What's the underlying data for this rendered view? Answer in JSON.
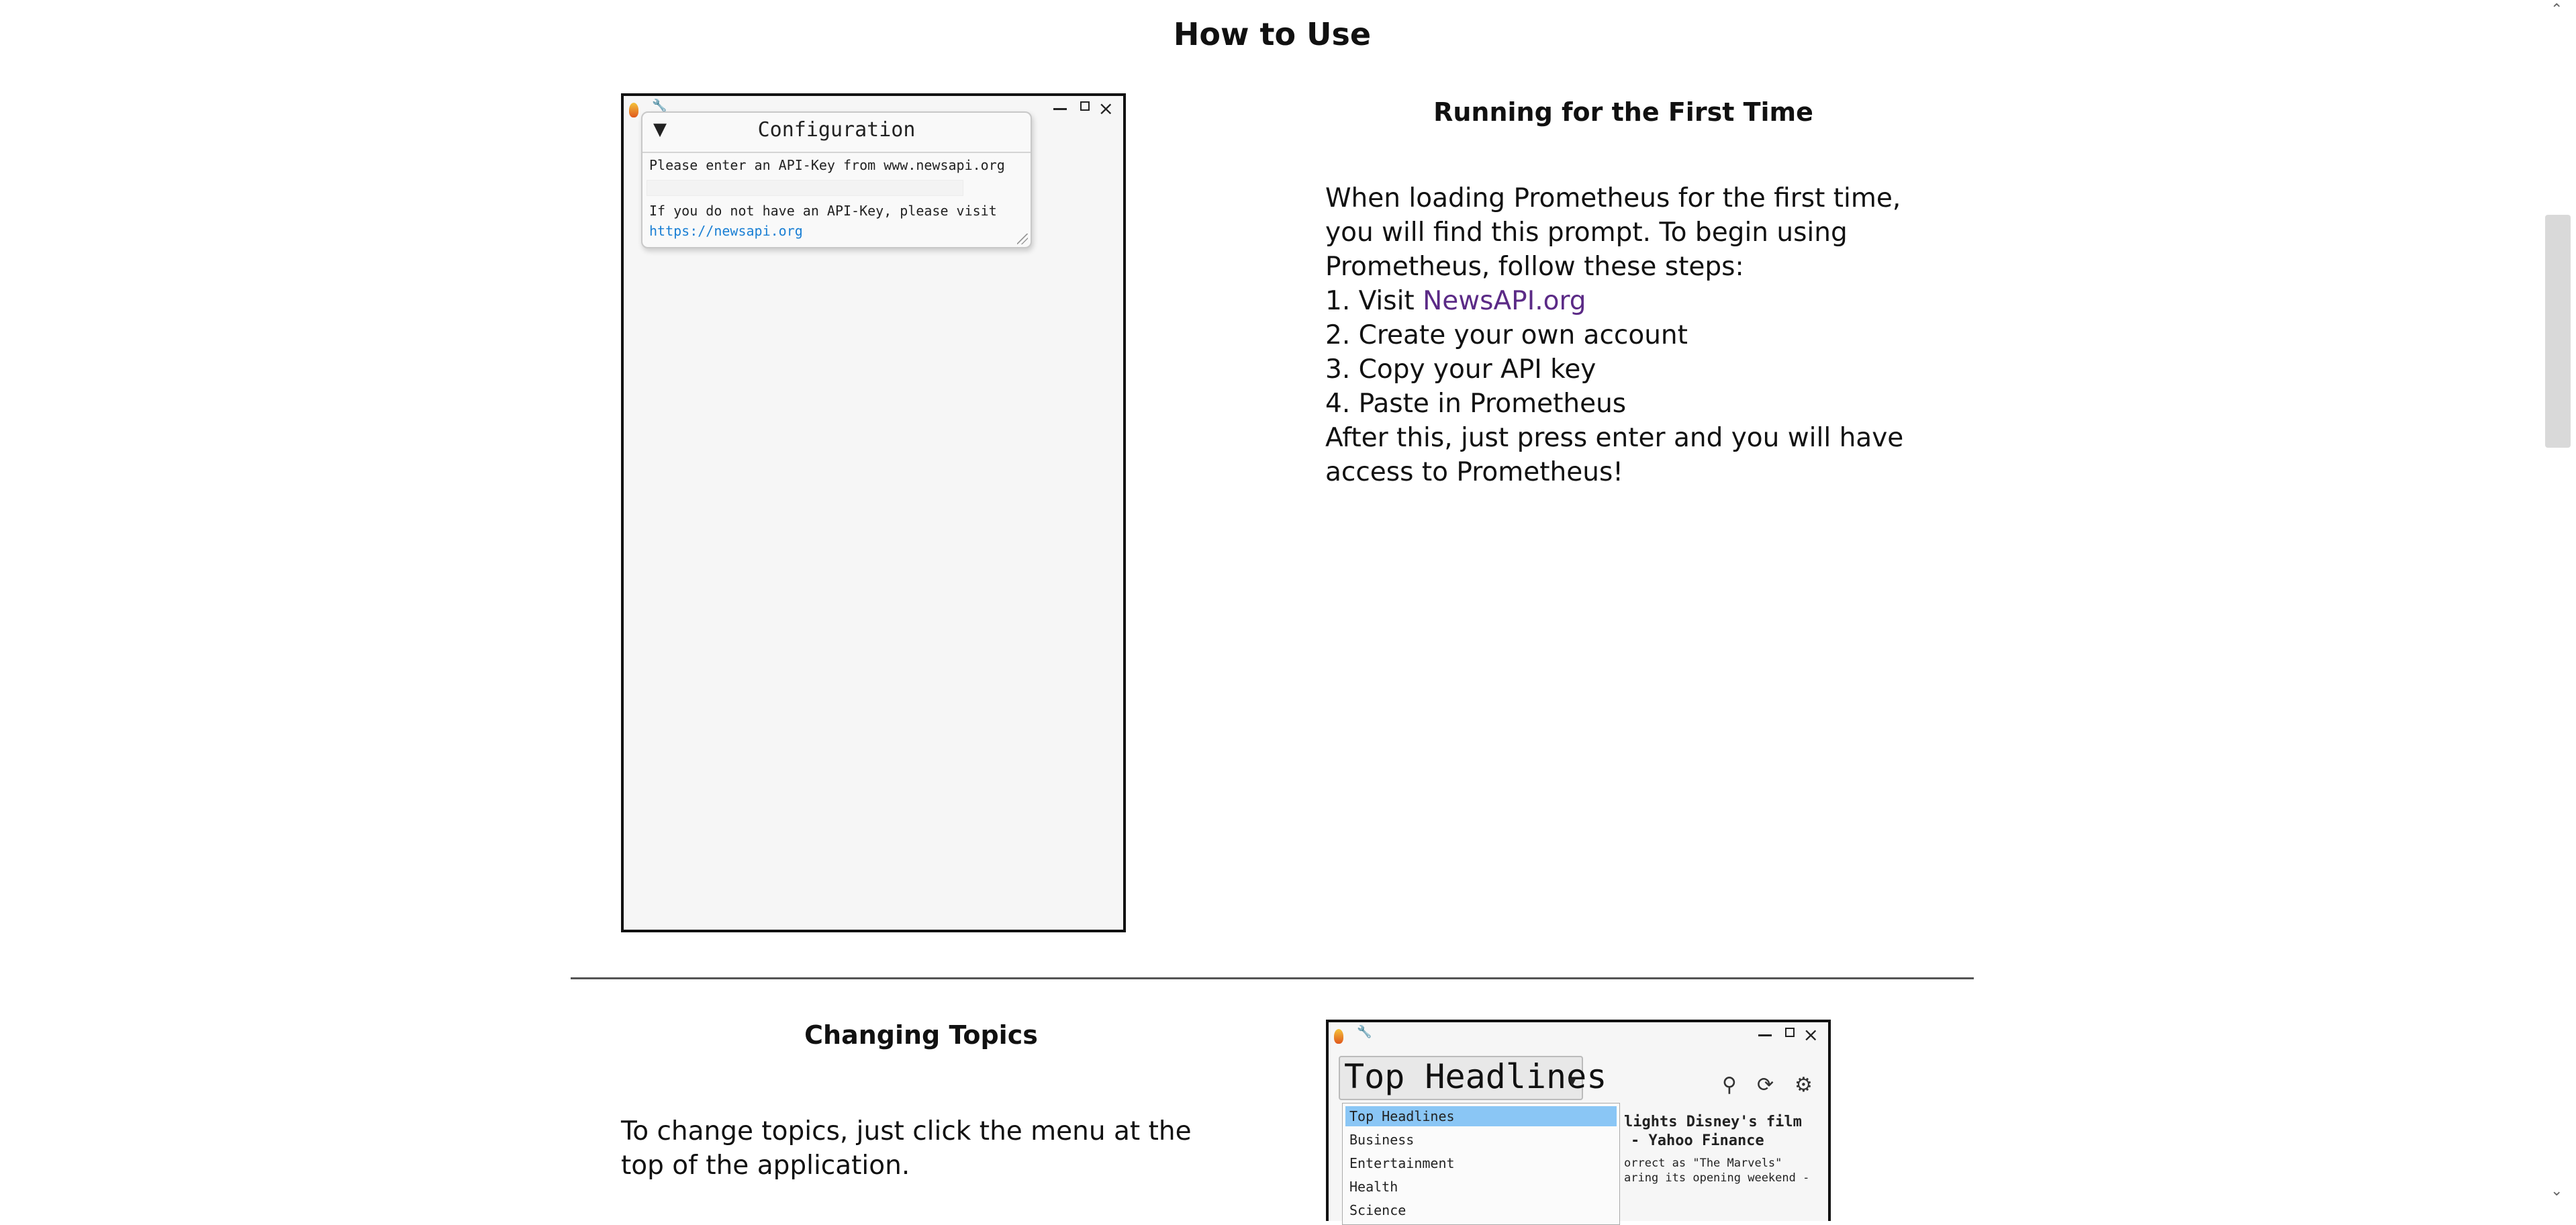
{
  "page": {
    "title": "How to Use"
  },
  "config_window": {
    "dialog_title": "Configuration",
    "prompt": "Please enter an API-Key from www.newsapi.org",
    "no_key_text": "If you do not have an API-Key, please visit",
    "link": "https://newsapi.org"
  },
  "first_time": {
    "title": "Running for the First Time",
    "line1": "When loading Prometheus for the first time,",
    "line2": "you will find this prompt.  To begin using",
    "line3": "Prometheus, follow these steps:",
    "step1_prefix": "1. Visit ",
    "step1_link": "NewsAPI.org",
    "step2": "2. Create your own account",
    "step3": "3. Copy your API key",
    "step4": "4. Paste in Prometheus",
    "after1": "After this, just press enter and you will have",
    "after2": "access to Prometheus!"
  },
  "changing_topics": {
    "title": "Changing Topics",
    "line1": "To change topics, just click the menu at the",
    "line2": "top of the application."
  },
  "topics_window": {
    "selected": "Top Headlines",
    "options": [
      "Top Headlines",
      "Business",
      "Entertainment",
      "Health",
      "Science"
    ],
    "headline_fragment_1": "lights Disney's film",
    "headline_fragment_2": "- Yahoo Finance",
    "desc_fragment_1": "orrect as \"The Marvels\"",
    "desc_fragment_2": "aring its opening weekend -"
  },
  "icons": [
    "app-flame-icon",
    "wrench-icon",
    "minimize-icon",
    "maximize-icon",
    "close-icon",
    "search-icon",
    "refresh-icon",
    "gear-icon"
  ]
}
